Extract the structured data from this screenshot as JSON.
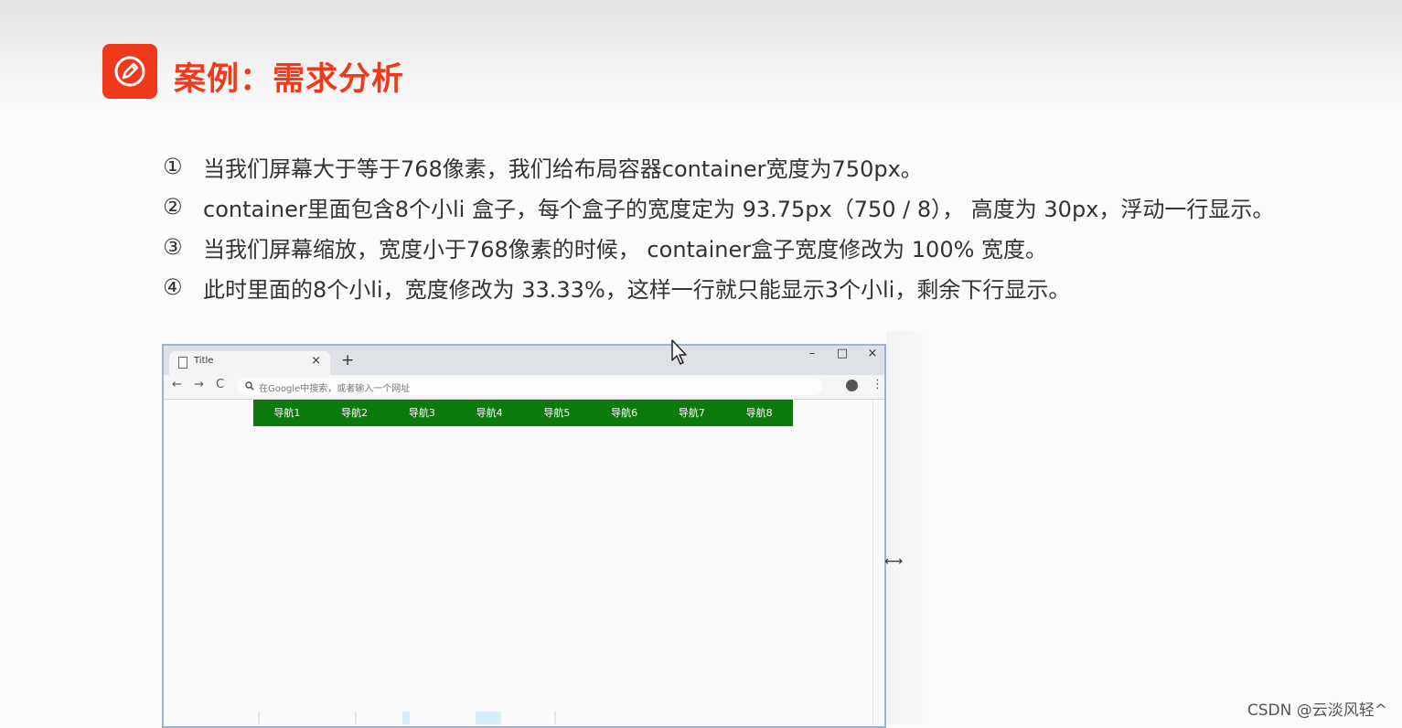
{
  "slide": {
    "title": "案例：需求分析",
    "title_icon": "pencil-icon",
    "accent_color": "#f0391a"
  },
  "requirements": [
    {
      "num": "①",
      "text": "当我们屏幕大于等于768像素，我们给布局容器container宽度为750px。"
    },
    {
      "num": "②",
      "text": "container里面包含8个小li  盒子，每个盒子的宽度定为 93.75px（750 / 8）， 高度为 30px，浮动一行显示。"
    },
    {
      "num": "③",
      "text": "当我们屏幕缩放，宽度小于768像素的时候， container盒子宽度修改为 100% 宽度。"
    },
    {
      "num": "④",
      "text": "此时里面的8个小li，宽度修改为 33.33%，这样一行就只能显示3个小li，剩余下行显示。"
    }
  ],
  "browser": {
    "tab_title": "Title",
    "tab_close": "×",
    "new_tab": "+",
    "window_buttons": {
      "minimize": "–",
      "maximize": "□",
      "close": "×"
    },
    "nav": {
      "back": "←",
      "forward": "→",
      "reload": "C"
    },
    "omnibox_placeholder": "在Google中搜索，或者输入一个网址",
    "more_menu": "⋮",
    "nav_items": [
      "导航1",
      "导航2",
      "导航3",
      "导航4",
      "导航5",
      "导航6",
      "导航7",
      "导航8"
    ],
    "nav_color": "#0b7a0b"
  },
  "watermark": "CSDN @云淡风轻^"
}
